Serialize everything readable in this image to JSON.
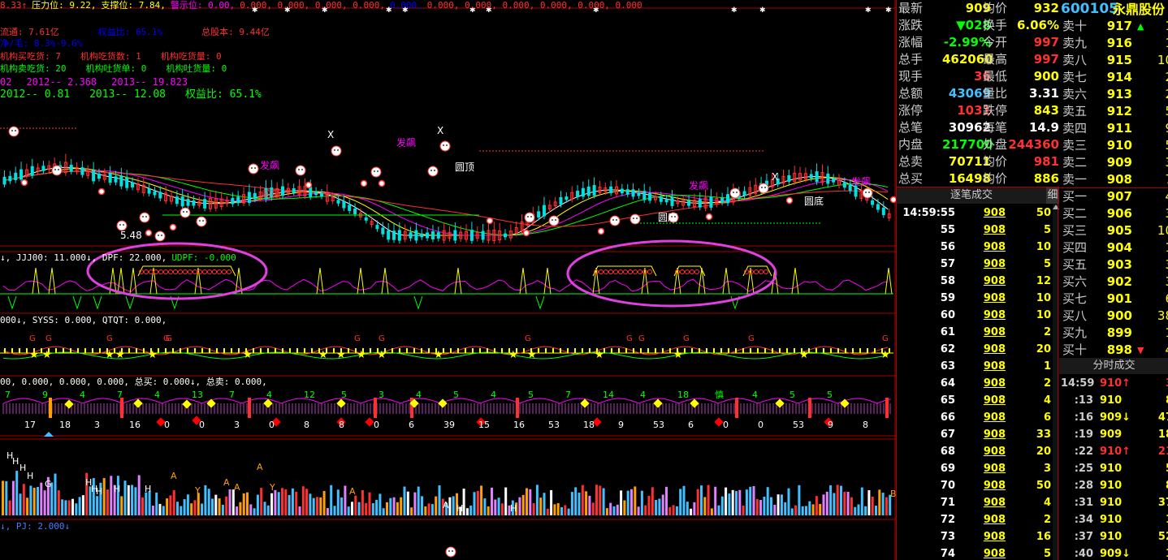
{
  "header": {
    "line1": [
      {
        "text": "8.33↑",
        "color": "#ff3030"
      },
      {
        "text": "压力位: 9.22,",
        "color": "#ffff00"
      },
      {
        "text": "支撑位: 7.84,",
        "color": "#ffff00"
      },
      {
        "text": "警示位: 0.00,",
        "color": "#ff00ff"
      },
      {
        "text": "0.000, 0.000, 0.000, 0.000,",
        "color": "#ff3030"
      },
      {
        "text": "0.000,",
        "color": "#0000ff"
      },
      {
        "text": "0.000, 0.000, 0.000, 0.000, 0.000, 0.000",
        "color": "#ff3030"
      }
    ],
    "line2": [
      {
        "text": "流通: 7.61亿",
        "color": "#ff3030"
      },
      {
        "text": "权益比: 65.1%",
        "color": "#0000ff"
      },
      {
        "text": "总股本: 9.44亿",
        "color": "#ff3030"
      }
    ],
    "line3": [
      {
        "text": "净/毛: 8.3%-9.6%",
        "color": "#0000ff"
      }
    ],
    "line4": [
      {
        "text": "机构买吃货: 7",
        "color": "#ff3030"
      },
      {
        "text": "机构吃货数: 1",
        "color": "#ff3030"
      },
      {
        "text": "机构吃货量: 0",
        "color": "#ff3030"
      }
    ],
    "line5": [
      {
        "text": "机构卖吃货: 20",
        "color": "#00ff00"
      },
      {
        "text": "机构吐货单: 0",
        "color": "#00ff00"
      },
      {
        "text": "机构吐货量: 0",
        "color": "#00ff00"
      }
    ],
    "line6": [
      {
        "text": "02",
        "color": "#ff00ff"
      },
      {
        "text": "2012-- 2.368",
        "color": "#ff00ff"
      },
      {
        "text": "2013-- 19.823",
        "color": "#ff00ff"
      }
    ],
    "line7": [
      {
        "text": "2012-- 0.81",
        "color": "#00ff00"
      },
      {
        "text": "2013-- 12.08",
        "color": "#00ff00"
      },
      {
        "text": "权益比: 65.1%",
        "color": "#00ff00"
      }
    ]
  },
  "chart_annotations": {
    "fa_piao": "发飙",
    "qian_ju": "前鼓",
    "yuan_ding": "圆顶",
    "yuan_di": "圆底",
    "price_low": "5.48",
    "x_mark": "X"
  },
  "panels": {
    "p2": [
      {
        "text": "↓, JJJ00: 11.000↓, DPF: 22.000,",
        "color": "#ffffff"
      },
      {
        "text": "UDPF: -0.000",
        "color": "#00ff00"
      }
    ],
    "p3": [
      {
        "text": "000↓, SYSS: 0.000, QTQT: 0.000,",
        "color": "#ffffff"
      }
    ],
    "p4": [
      {
        "text": "00, 0.000, 0.000, 0.000, 总买: 0.000↓, 总卖: 0.000,",
        "color": "#ffffff"
      }
    ],
    "p6": [
      {
        "text": "↓, PJ: 2.000↓",
        "color": "#4080ff"
      }
    ],
    "p4_labels": [
      "17",
      "18",
      "3",
      "16",
      "0",
      "0",
      "3",
      "0",
      "8",
      "8",
      "0",
      "6",
      "39",
      "15",
      "16",
      "53",
      "18",
      "9",
      "53",
      "6",
      "0",
      "0",
      "53",
      "9",
      "8"
    ],
    "p4_top": [
      "7",
      "9",
      "4",
      "7",
      "4",
      "13",
      "7",
      "4",
      "12",
      "5",
      "3",
      "4",
      "5",
      "4",
      "5",
      "7",
      "14",
      "4",
      "18",
      "慎",
      "4",
      "5",
      "5"
    ],
    "p5_letters": [
      "H",
      "H",
      "H",
      "H",
      "G",
      "H",
      "H",
      "H",
      "H",
      "H",
      "A",
      "Y",
      "A",
      "A",
      "Y",
      "A",
      "A",
      "A",
      "H",
      "H",
      "B"
    ]
  },
  "quote": {
    "code": "600105",
    "name": "永鼎股份",
    "rows": [
      {
        "l1": "最新",
        "v1": "909",
        "c1": "#ffff00",
        "l2": "均价",
        "v2": "932",
        "c2": "#ffff00"
      },
      {
        "l1": "涨跌",
        "v1": "▼028",
        "c1": "#00ff00",
        "l2": "换手",
        "v2": "6.06%",
        "c2": "#ffff00"
      },
      {
        "l1": "涨幅",
        "v1": "-2.99%",
        "c1": "#00ff00",
        "l2": "今开",
        "v2": "997",
        "c2": "#ff3030"
      },
      {
        "l1": "总手",
        "v1": "462060",
        "c1": "#ffff00",
        "l2": "最高",
        "v2": "997",
        "c2": "#ff3030"
      },
      {
        "l1": "现手",
        "v1": "36",
        "c1": "#ff3030",
        "l2": "最低",
        "v2": "900",
        "c2": "#ffff00"
      },
      {
        "l1": "总额",
        "v1": "43069",
        "c1": "#40c0ff",
        "l2": "量比",
        "v2": "3.31",
        "c2": "#ffffff"
      },
      {
        "l1": "涨停",
        "v1": "1031",
        "c1": "#ff3030",
        "l2": "跌停",
        "v2": "843",
        "c2": "#ffff00"
      },
      {
        "l1": "总笔",
        "v1": "30962",
        "c1": "#ffffff",
        "l2": "每笔",
        "v2": "14.9",
        "c2": "#ffffff"
      },
      {
        "l1": "内盘",
        "v1": "217700",
        "c1": "#00ff00",
        "l2": "外盘",
        "v2": "244360",
        "c2": "#ff3030"
      },
      {
        "l1": "总卖",
        "v1": "70711",
        "c1": "#ffff00",
        "l2": "均价",
        "v2": "981",
        "c2": "#ff3030"
      },
      {
        "l1": "总买",
        "v1": "16498",
        "c1": "#ffff00",
        "l2": "均价",
        "v2": "886",
        "c2": "#ffff00"
      }
    ]
  },
  "orderbook": {
    "sell": [
      {
        "label": "卖十",
        "price": "917",
        "vol": "1",
        "flag": "▲"
      },
      {
        "label": "卖九",
        "price": "916",
        "vol": "1"
      },
      {
        "label": "卖八",
        "price": "915",
        "vol": "10"
      },
      {
        "label": "卖七",
        "price": "914",
        "vol": "2"
      },
      {
        "label": "卖六",
        "price": "913",
        "vol": "2"
      },
      {
        "label": "卖五",
        "price": "912",
        "vol": "5"
      },
      {
        "label": "卖四",
        "price": "911",
        "vol": "9"
      },
      {
        "label": "卖三",
        "price": "910",
        "vol": "5"
      },
      {
        "label": "卖二",
        "price": "909",
        "vol": "3"
      },
      {
        "label": "卖一",
        "price": "908",
        "vol": "7"
      }
    ],
    "buy": [
      {
        "label": "买一",
        "price": "907",
        "vol": "4"
      },
      {
        "label": "买二",
        "price": "906",
        "vol": "3"
      },
      {
        "label": "买三",
        "price": "905",
        "vol": "10"
      },
      {
        "label": "买四",
        "price": "904",
        "vol": "1"
      },
      {
        "label": "买五",
        "price": "903",
        "vol": "3"
      },
      {
        "label": "买六",
        "price": "902",
        "vol": "3"
      },
      {
        "label": "买七",
        "price": "901",
        "vol": "6"
      },
      {
        "label": "买八",
        "price": "900",
        "vol": "38"
      },
      {
        "label": "买九",
        "price": "899",
        "vol": "1"
      },
      {
        "label": "买十",
        "price": "898",
        "vol": "4",
        "flag": "▼"
      }
    ]
  },
  "tick_title": "逐笔成交",
  "tick_tab": "细",
  "ticks": [
    {
      "t": "14:59:55",
      "p": "908",
      "v": "50"
    },
    {
      "t": "55",
      "p": "908",
      "v": "5"
    },
    {
      "t": "56",
      "p": "908",
      "v": "10"
    },
    {
      "t": "57",
      "p": "908",
      "v": "5"
    },
    {
      "t": "58",
      "p": "908",
      "v": "12"
    },
    {
      "t": "59",
      "p": "908",
      "v": "10"
    },
    {
      "t": "60",
      "p": "908",
      "v": "10"
    },
    {
      "t": "61",
      "p": "908",
      "v": "2"
    },
    {
      "t": "62",
      "p": "908",
      "v": "20"
    },
    {
      "t": "63",
      "p": "908",
      "v": "1"
    },
    {
      "t": "64",
      "p": "908",
      "v": "2"
    },
    {
      "t": "65",
      "p": "908",
      "v": "4"
    },
    {
      "t": "66",
      "p": "908",
      "v": "6"
    },
    {
      "t": "67",
      "p": "908",
      "v": "33"
    },
    {
      "t": "68",
      "p": "908",
      "v": "20"
    },
    {
      "t": "69",
      "p": "908",
      "v": "3"
    },
    {
      "t": "70",
      "p": "908",
      "v": "50"
    },
    {
      "t": "71",
      "p": "908",
      "v": "4"
    },
    {
      "t": "72",
      "p": "908",
      "v": "2"
    },
    {
      "t": "73",
      "p": "908",
      "v": "16"
    },
    {
      "t": "74",
      "p": "908",
      "v": "5"
    }
  ],
  "minute_title": "分时成交",
  "minutes": [
    {
      "t": "14:59",
      "p": "910↑",
      "v": "3"
    },
    {
      "t": ":13",
      "p": "910",
      "v": "8"
    },
    {
      "t": ":16",
      "p": "909↓",
      "v": "47"
    },
    {
      "t": ":19",
      "p": "909",
      "v": "18"
    },
    {
      "t": ":22",
      "p": "910↑",
      "v": "21"
    },
    {
      "t": ":25",
      "p": "910",
      "v": "5"
    },
    {
      "t": ":28",
      "p": "910",
      "v": "8"
    },
    {
      "t": ":31",
      "p": "910",
      "v": "37"
    },
    {
      "t": ":34",
      "p": "910",
      "v": "1"
    },
    {
      "t": ":37",
      "p": "910",
      "v": "52"
    },
    {
      "t": ":40",
      "p": "909↓",
      "v": "1"
    }
  ]
}
